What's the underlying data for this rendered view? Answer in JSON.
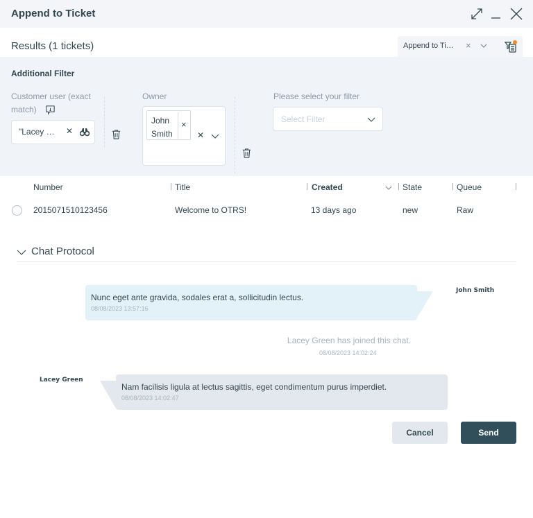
{
  "dialog": {
    "title": "Append to Ticket",
    "icons": [
      "expand-icon",
      "minimize-icon",
      "close-icon"
    ]
  },
  "results": {
    "label": "Results (1 tickets)",
    "view_select": {
      "value": "Append to Ti…",
      "clear_icon": "×"
    },
    "filter_notification_color": "#f08a24"
  },
  "additional_filter": {
    "title": "Additional Filter",
    "customer_user": {
      "label_line1": "Customer user (exact",
      "label_line2": "match)",
      "value": "\"Lacey …",
      "clear": "✕"
    },
    "owner": {
      "label": "Owner",
      "tag_line1": "John",
      "tag_line2": "Smith",
      "tag_remove": "×",
      "clear": "✕"
    },
    "filter_select": {
      "label": "Please select your filter",
      "placeholder": "Select Filter"
    }
  },
  "table": {
    "columns": [
      {
        "label": "Number",
        "sorted": false
      },
      {
        "label": "Title",
        "sorted": false
      },
      {
        "label": "Created",
        "sorted": true
      },
      {
        "label": "State",
        "sorted": false
      },
      {
        "label": "Queue",
        "sorted": false
      }
    ],
    "rows": [
      {
        "number": "2015071510123456",
        "title": "Welcome to OTRS!",
        "created": "13 days ago",
        "state": "new",
        "queue": "Raw",
        "selected": false
      }
    ]
  },
  "chat_protocol": {
    "title": "Chat Protocol",
    "messages": [
      {
        "author": "John Smith",
        "text": "Nunc eget ante gravida, sodales erat a, sollicitudin lectus.",
        "timestamp": "08/08/2023 13:57:16",
        "side": "right"
      },
      {
        "system": true,
        "text": "Lacey Green has joined this chat.",
        "timestamp": "08/08/2023 14:02:24"
      },
      {
        "author": "Lacey Green",
        "text": "Nam facilisis ligula at lectus sagittis, eget condimentum purus imperdiet.",
        "timestamp": "08/08/2023 14:02:47",
        "side": "left"
      }
    ]
  },
  "actions": {
    "cancel": "Cancel",
    "send": "Send"
  },
  "colors": {
    "header_bg": "#f3f5f9",
    "filter_bg": "#f0f3f8",
    "primary_button": "#304f5a",
    "agent_bubble": "#e3f1f9",
    "customer_bubble": "#e3e8ee",
    "text": "#33474f"
  }
}
